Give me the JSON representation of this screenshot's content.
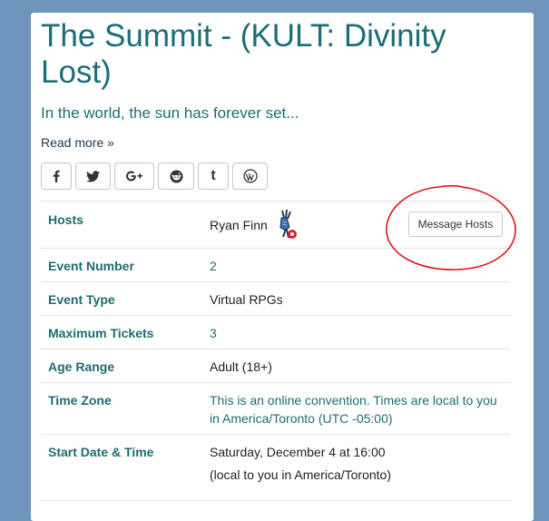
{
  "event": {
    "title": "The Summit - (KULT: Divinity Lost)",
    "lead": "In the world, the sun has forever set...",
    "read_more": "Read more »"
  },
  "share_buttons": [
    "facebook-icon",
    "twitter-icon",
    "google-plus-icon",
    "reddit-icon",
    "tumblr-icon",
    "wordpress-icon"
  ],
  "share_glyphs": {
    "twitter": "𝕥",
    "tumblr": "t",
    "google": "G+"
  },
  "details": {
    "hosts_label": "Hosts",
    "host_name": "Ryan Finn",
    "message_hosts": "Message Hosts",
    "event_number_label": "Event Number",
    "event_number": "2",
    "event_type_label": "Event Type",
    "event_type": "Virtual RPGs",
    "max_tickets_label": "Maximum Tickets",
    "max_tickets": "3",
    "age_range_label": "Age Range",
    "age_range": "Adult (18+)",
    "time_zone_label": "Time Zone",
    "time_zone_line1": "This is an online convention. Times are local to you",
    "time_zone_line2": "in America/Toronto (UTC -05:00)",
    "start_label": "Start Date & Time",
    "start_value": "Saturday, December 4 at 16:00",
    "start_note": "(local to you in America/Toronto)"
  },
  "colors": {
    "page_background": "#6f95bd",
    "heading_teal": "#1b6e77",
    "annotation_red": "#e0141e"
  }
}
